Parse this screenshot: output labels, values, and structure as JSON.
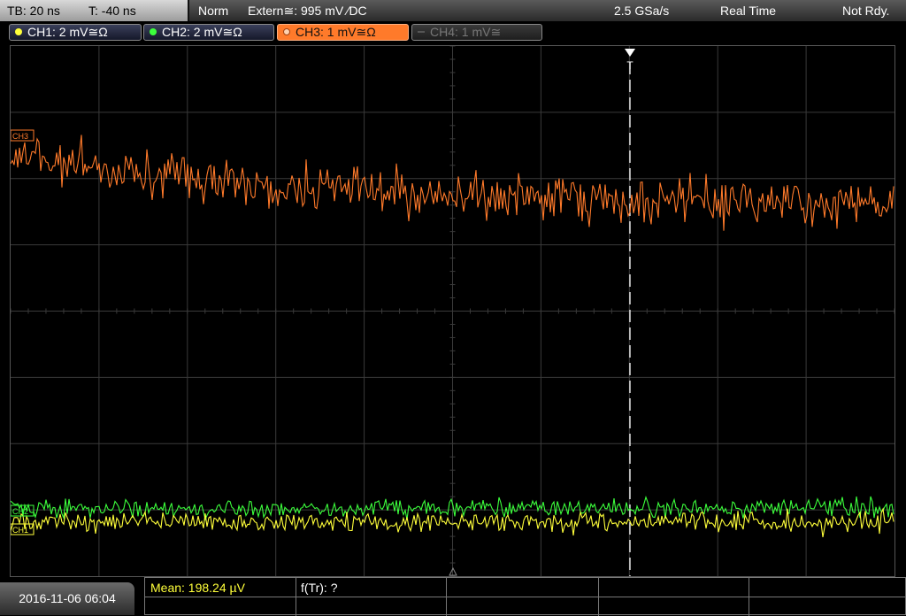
{
  "topbar": {
    "timebase": "TB: 20 ns",
    "trigger_time": "T: -40 ns",
    "mode": "Norm",
    "trigger_source": "Extern≅: 995 mV ∕DC",
    "sample_rate": "2.5 GSa/s",
    "acquisition": "Real Time",
    "status": "Not Rdy."
  },
  "channels": [
    {
      "label": "CH1: 2 mV≅Ω",
      "color": "#ffff3a",
      "active": true
    },
    {
      "label": "CH2: 2 mV≅Ω",
      "color": "#3cff3c",
      "active": true
    },
    {
      "label": "CH3: 1 mV≅Ω",
      "color": "#ff7a2a",
      "active": true,
      "selected": true
    },
    {
      "label": "CH4: 1 mV≅",
      "color": "#777777",
      "active": false
    }
  ],
  "markers": {
    "ch3": "CH3",
    "ch2": "CH2",
    "ch1": "CH1",
    "trigger": "T"
  },
  "colors": {
    "ch1": "#ffff3a",
    "ch2": "#3cff3c",
    "ch3": "#ff7a2a",
    "grid": "#3a3a3a"
  },
  "bottombar": {
    "datetime": "2016-11-06 06:04",
    "mean_label": "Mean: 198.24 µV",
    "ftr_label": "f(Tr): ?"
  }
}
